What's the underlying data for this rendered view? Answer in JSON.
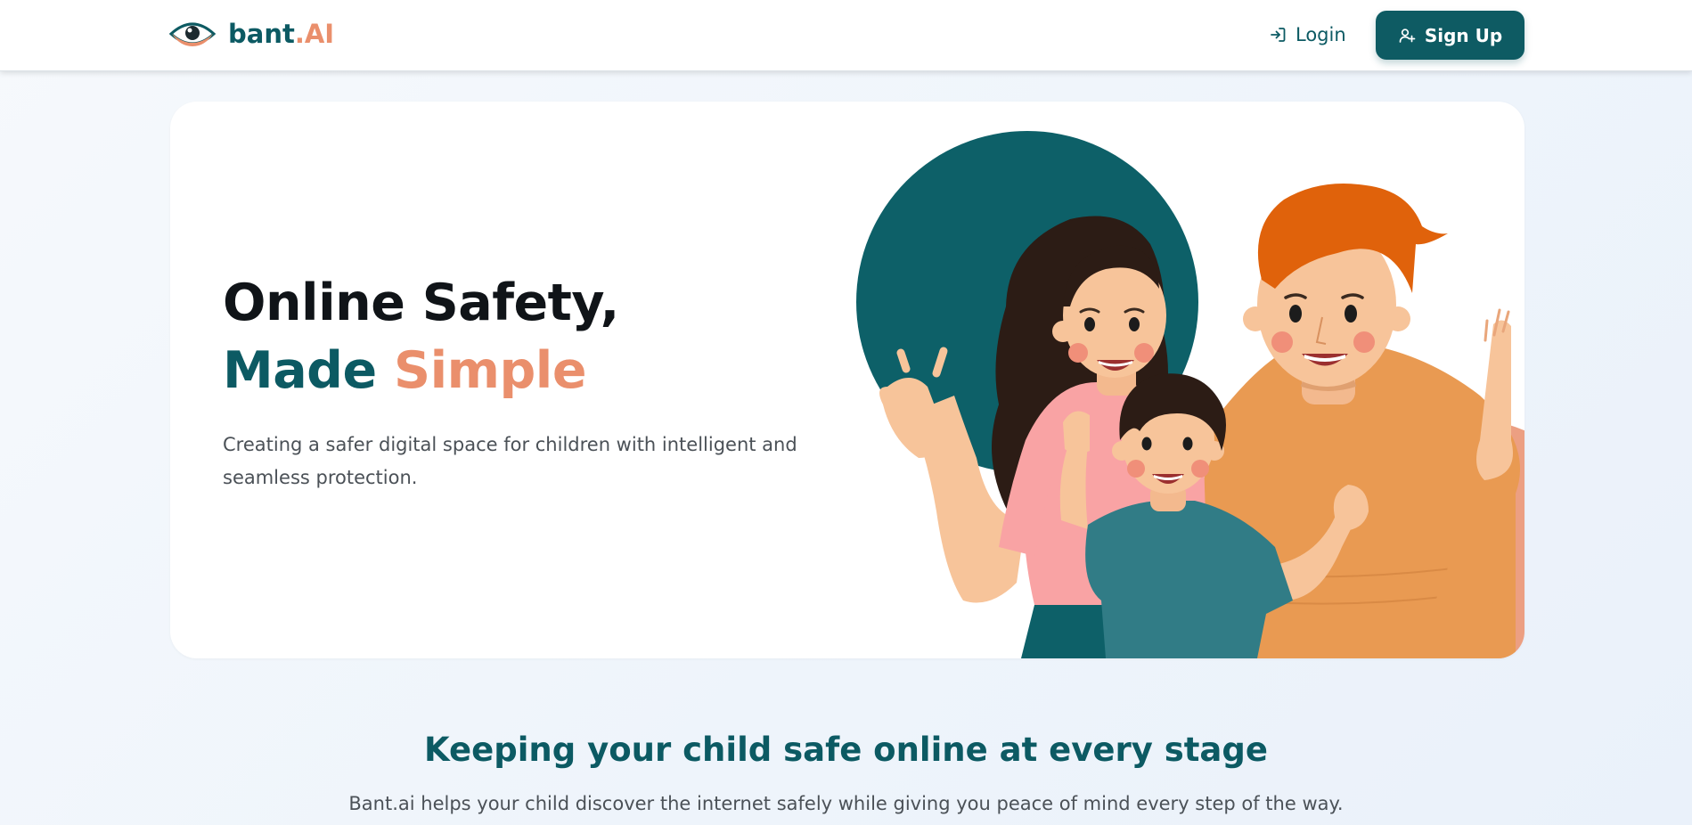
{
  "header": {
    "brand_main": "bant",
    "brand_accent": ".AI",
    "login_label": "Login",
    "signup_label": "Sign Up",
    "icons": {
      "logo": "eye-logo-icon",
      "login": "login-arrow-icon",
      "signup": "user-plus-icon"
    }
  },
  "hero": {
    "title_line1": "Online Safety,",
    "title_line2a": "Made",
    "title_line2b": "Simple",
    "subtitle": "Creating a safer digital space for children with intelligent and seamless protection."
  },
  "section": {
    "title": "Keeping your child safe online at every stage",
    "subtitle": "Bant.ai helps your child discover the internet safely while giving you peace of mind every step of the way."
  },
  "colors": {
    "brand_teal": "#0e5b63",
    "brand_orange": "#ea8f6c",
    "text_dark": "#101418",
    "text_muted": "#4b5157"
  }
}
